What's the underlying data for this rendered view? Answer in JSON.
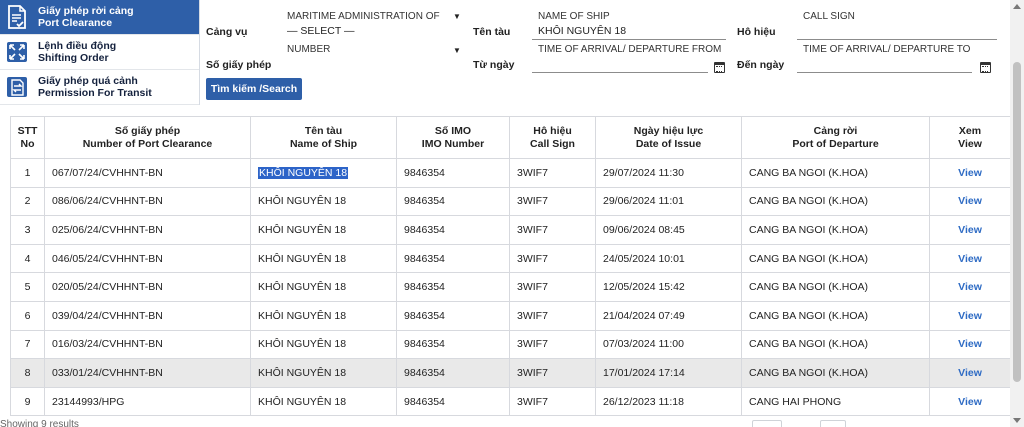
{
  "nav": [
    {
      "line1": "Giấy phép rời cảng",
      "line2": "Port Clearance",
      "icon": "document-check-icon",
      "active": true
    },
    {
      "line1": "Lệnh điều động",
      "line2": "Shifting Order",
      "icon": "expand-arrows-icon",
      "active": false
    },
    {
      "line1": "Giấy phép quá cảnh",
      "line2": "Permission For Transit",
      "icon": "document-transfer-icon",
      "active": false
    }
  ],
  "form": {
    "port_label": "Cảng vụ",
    "port_placeholder": "MARITIME ADMINISTRATION OF",
    "port_value": "— SELECT —",
    "ship_label": "Tên tàu",
    "ship_placeholder": "NAME OF SHIP",
    "ship_value": "KHÔI NGUYÊN 18",
    "callsign_label": "Hô hiệu",
    "callsign_placeholder": "CALL SIGN",
    "callsign_value": "",
    "permit_label": "Số giấy phép",
    "permit_placeholder": "NUMBER",
    "permit_value": "",
    "from_label": "Từ ngày",
    "from_placeholder": "TIME OF ARRIVAL/ DEPARTURE FROM",
    "from_value": "",
    "to_label": "Đến ngày",
    "to_placeholder": "TIME OF ARRIVAL/ DEPARTURE TO",
    "to_value": "",
    "search_button": "Tìm kiếm /Search"
  },
  "table": {
    "headers": [
      {
        "vi": "STT",
        "en": "No"
      },
      {
        "vi": "Số giấy phép",
        "en": "Number of Port Clearance"
      },
      {
        "vi": "Tên tàu",
        "en": "Name of Ship"
      },
      {
        "vi": "Số IMO",
        "en": "IMO Number"
      },
      {
        "vi": "Hô hiệu",
        "en": "Call Sign"
      },
      {
        "vi": "Ngày hiệu lực",
        "en": "Date of Issue"
      },
      {
        "vi": "Cảng rời",
        "en": "Port of Departure"
      },
      {
        "vi": "Xem",
        "en": "View"
      }
    ],
    "view_label": "View",
    "highlighted_row": 8,
    "rows": [
      {
        "no": "1",
        "number": "067/07/24/CVHHNT-BN",
        "ship": "KHÔI NGUYÊN 18",
        "imo": "9846354",
        "callsign": "3WIF7",
        "date": "29/07/2024 11:30",
        "port": "CANG BA NGOI (K.HOA)"
      },
      {
        "no": "2",
        "number": "086/06/24/CVHHNT-BN",
        "ship": "KHÔI NGUYÊN 18",
        "imo": "9846354",
        "callsign": "3WIF7",
        "date": "29/06/2024 11:01",
        "port": "CANG BA NGOI (K.HOA)"
      },
      {
        "no": "3",
        "number": "025/06/24/CVHHNT-BN",
        "ship": "KHÔI NGUYÊN 18",
        "imo": "9846354",
        "callsign": "3WIF7",
        "date": "09/06/2024 08:45",
        "port": "CANG BA NGOI (K.HOA)"
      },
      {
        "no": "4",
        "number": "046/05/24/CVHHNT-BN",
        "ship": "KHÔI NGUYÊN 18",
        "imo": "9846354",
        "callsign": "3WIF7",
        "date": "24/05/2024 10:01",
        "port": "CANG BA NGOI (K.HOA)"
      },
      {
        "no": "5",
        "number": "020/05/24/CVHHNT-BN",
        "ship": "KHÔI NGUYÊN 18",
        "imo": "9846354",
        "callsign": "3WIF7",
        "date": "12/05/2024 15:42",
        "port": "CANG BA NGOI (K.HOA)"
      },
      {
        "no": "6",
        "number": "039/04/24/CVHHNT-BN",
        "ship": "KHÔI NGUYÊN 18",
        "imo": "9846354",
        "callsign": "3WIF7",
        "date": "21/04/2024 07:49",
        "port": "CANG BA NGOI (K.HOA)"
      },
      {
        "no": "7",
        "number": "016/03/24/CVHHNT-BN",
        "ship": "KHÔI NGUYÊN 18",
        "imo": "9846354",
        "callsign": "3WIF7",
        "date": "07/03/2024 11:00",
        "port": "CANG BA NGOI (K.HOA)"
      },
      {
        "no": "8",
        "number": "033/01/24/CVHHNT-BN",
        "ship": "KHÔI NGUYÊN 18",
        "imo": "9846354",
        "callsign": "3WIF7",
        "date": "17/01/2024 17:14",
        "port": "CANG BA NGOI (K.HOA)"
      },
      {
        "no": "9",
        "number": "23144993/HPG",
        "ship": "KHÔI NGUYÊN 18",
        "imo": "9846354",
        "callsign": "3WIF7",
        "date": "26/12/2023 11:18",
        "port": "CANG HAI PHONG"
      }
    ]
  },
  "footer": {
    "results": "Showing 9 results"
  }
}
